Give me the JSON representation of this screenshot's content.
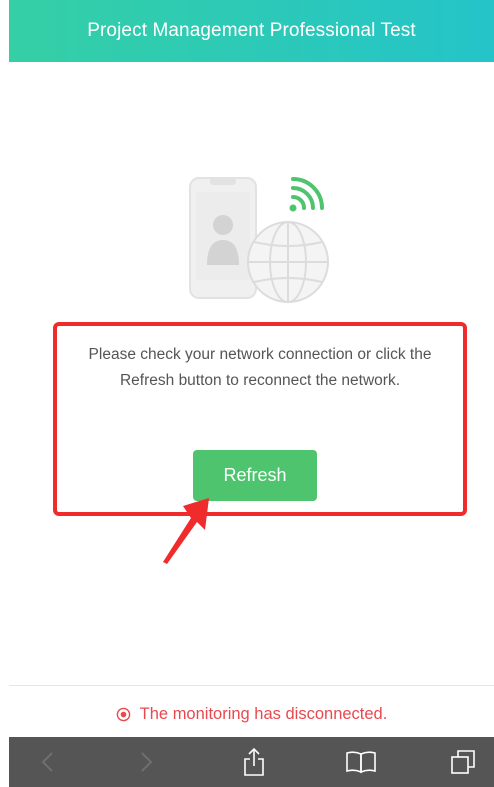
{
  "header": {
    "title": "Project Management Professional Test",
    "gradient_start": "#35cfa5",
    "gradient_end": "#24c4c9"
  },
  "illustration": {
    "icons": [
      "phone-icon",
      "person-icon",
      "globe-icon",
      "wifi-icon"
    ]
  },
  "error_panel": {
    "message": "Please check your network connection or click the Refresh button to reconnect the network.",
    "highlight_color": "#ef2b2b"
  },
  "refresh_button": {
    "label": "Refresh",
    "color": "#4ec46f"
  },
  "status": {
    "text": "The monitoring has disconnected.",
    "color": "#e8494f",
    "icon": "record-icon"
  },
  "toolbar": {
    "items": [
      "back-icon",
      "forward-icon",
      "share-icon",
      "bookmarks-icon",
      "tabs-icon"
    ]
  }
}
